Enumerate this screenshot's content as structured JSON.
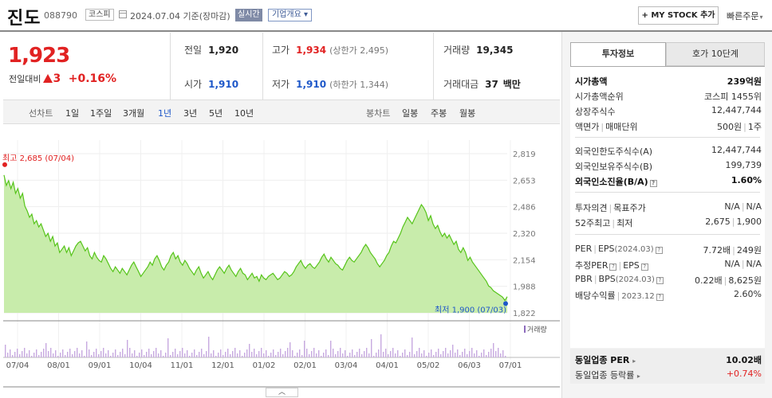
{
  "header": {
    "name": "진도",
    "code": "088790",
    "market_badge": "코스피",
    "date_text": "2024.07.04  기준(장마감)",
    "realtime_badge": "실시간",
    "corp_overview": "기업개요",
    "corp_overview_arrow": "▾",
    "my_stock_button": "+ MY STOCK 추가",
    "quick_order": "빠른주문",
    "quick_order_arrow": "▾"
  },
  "price": {
    "current": "1,923",
    "change_label": "전일대비",
    "change_amount": "3",
    "change_pct": "+0.16%"
  },
  "stats": {
    "prev_label": "전일",
    "prev_value": "1,920",
    "high_label": "고가",
    "high_value": "1,934",
    "upper_limit": "(상한가 2,495)",
    "volume_label": "거래량",
    "volume_value": "19,345",
    "open_label": "시가",
    "open_value": "1,910",
    "low_label": "저가",
    "low_value": "1,910",
    "lower_limit": "(하한가 1,344)",
    "amount_label": "거래대금",
    "amount_value": "37",
    "amount_unit": "백만"
  },
  "period_bar": {
    "line_label": "선차트",
    "line_periods": [
      "1일",
      "1주일",
      "3개월",
      "1년",
      "3년",
      "5년",
      "10년"
    ],
    "selected": "1년",
    "candle_label": "봉차트",
    "candle_periods": [
      "일봉",
      "주봉",
      "월봉"
    ]
  },
  "chart_data": {
    "type": "area",
    "y_ticks": [
      "2,819",
      "2,653",
      "2,486",
      "2,320",
      "2,154",
      "1,988",
      "1,822"
    ],
    "ylim": [
      1822,
      2819
    ],
    "x_ticks": [
      "07/04",
      "08/01",
      "09/01",
      "10/04",
      "11/01",
      "12/01",
      "01/02",
      "02/01",
      "03/04",
      "04/01",
      "05/02",
      "06/03",
      "07/01"
    ],
    "max_label": "최고 2,685 (07/04)",
    "min_label": "최저 1,900 (07/03)",
    "volume_label": "거래량",
    "accent_line": "#56c41a",
    "accent_fill": "#c8ecab",
    "max_color": "#e12222",
    "min_color": "#1f58c9",
    "series": [
      {
        "values": [
          2685,
          2620,
          2650,
          2600,
          2640,
          2570,
          2600,
          2540,
          2570,
          2490,
          2460,
          2420,
          2440,
          2380,
          2400,
          2360,
          2380,
          2340,
          2300,
          2320,
          2270,
          2300,
          2240,
          2260,
          2200,
          2220,
          2240,
          2200,
          2230,
          2180,
          2210,
          2240,
          2260,
          2270,
          2240,
          2210,
          2230,
          2180,
          2160,
          2200,
          2170,
          2150,
          2140,
          2180,
          2160,
          2130,
          2100,
          2080,
          2110,
          2090,
          2070,
          2100,
          2080,
          2060,
          2090,
          2120,
          2140,
          2110,
          2080,
          2050,
          2070,
          2090,
          2110,
          2140,
          2120,
          2160,
          2180,
          2150,
          2110,
          2090,
          2120,
          2140,
          2180,
          2200,
          2160,
          2180,
          2140,
          2120,
          2150,
          2130,
          2100,
          2080,
          2060,
          2090,
          2110,
          2070,
          2040,
          2060,
          2080,
          2050,
          2030,
          2060,
          2090,
          2110,
          2090,
          2070,
          2100,
          2120,
          2090,
          2070,
          2050,
          2080,
          2100,
          2070,
          2060,
          2030,
          2050,
          2070,
          2040,
          2050,
          2020,
          2060,
          2040,
          2030,
          2050,
          2060,
          2070,
          2050,
          2030,
          2040,
          2060,
          2080,
          2070,
          2050,
          2060,
          2080,
          2110,
          2130,
          2150,
          2120,
          2100,
          2120,
          2130,
          2110,
          2100,
          2120,
          2140,
          2170,
          2190,
          2160,
          2140,
          2170,
          2150,
          2130,
          2120,
          2100,
          2090,
          2120,
          2150,
          2170,
          2150,
          2140,
          2160,
          2180,
          2200,
          2230,
          2250,
          2230,
          2200,
          2180,
          2160,
          2130,
          2110,
          2130,
          2150,
          2180,
          2200,
          2240,
          2270,
          2260,
          2290,
          2320,
          2360,
          2390,
          2420,
          2400,
          2380,
          2410,
          2440,
          2470,
          2500,
          2480,
          2450,
          2400,
          2430,
          2380,
          2350,
          2370,
          2330,
          2300,
          2320,
          2290,
          2310,
          2280,
          2250,
          2270,
          2220,
          2200,
          2230,
          2200,
          2150,
          2170,
          2140,
          2120,
          2100,
          2080,
          2060,
          2040,
          2020,
          1990,
          1980,
          1960,
          1950,
          1940,
          1930,
          1920,
          1900,
          1923
        ]
      }
    ]
  },
  "right_panel": {
    "tab_active": "투자정보",
    "tab_other": "호가 10단계",
    "rows": {
      "mcap_label": "시가총액",
      "mcap_value": "239억원",
      "mcap_rank_label": "시가총액순위",
      "mcap_rank_value": "코스피 1455위",
      "shares_label": "상장주식수",
      "shares_value": "12,447,744",
      "par_label": "액면가",
      "par_sep": "|",
      "unit_label": "매매단위",
      "par_value": "500원",
      "par_value_sep": "|",
      "unit_value": "1주",
      "foreign_limit_label": "외국인한도주식수(A)",
      "foreign_limit_value": "12,447,744",
      "foreign_hold_label": "외국인보유주식수(B)",
      "foreign_hold_value": "199,739",
      "foreign_ratio_label": "외국인소진율(B/A)",
      "foreign_ratio_value": "1.60%",
      "opinion_label": "투자의견",
      "opinion_sep": "|",
      "target_label": "목표주가",
      "opinion_value": "N/A",
      "opinion_value_sep": "|",
      "target_value": "N/A",
      "wk52_label": "52주최고",
      "wk52_sep": "|",
      "wk52_low_label": "최저",
      "wk52_high": "2,675",
      "wk52_value_sep": "|",
      "wk52_low": "1,900",
      "per_label": "PER",
      "eps_label": "EPS",
      "eps_period": "(2024.03)",
      "per_value": "7.72배",
      "eps_value": "249원",
      "est_per_label": "추정PER",
      "est_eps_label": "EPS",
      "est_per_value": "N/A",
      "est_eps_value": "N/A",
      "pbr_label": "PBR",
      "bps_label": "BPS",
      "bps_period": "(2024.03)",
      "pbr_value": "0.22배",
      "bps_value": "8,625원",
      "div_label": "배당수익률",
      "div_period": "2023.12",
      "div_value": "2.60%",
      "sector_per_label": "동일업종 PER",
      "sector_per_value": "10.02배",
      "sector_chg_label": "동일업종 등락률",
      "sector_chg_value": "+0.74%"
    },
    "info_icon": "?"
  },
  "collapse_button": "︿"
}
